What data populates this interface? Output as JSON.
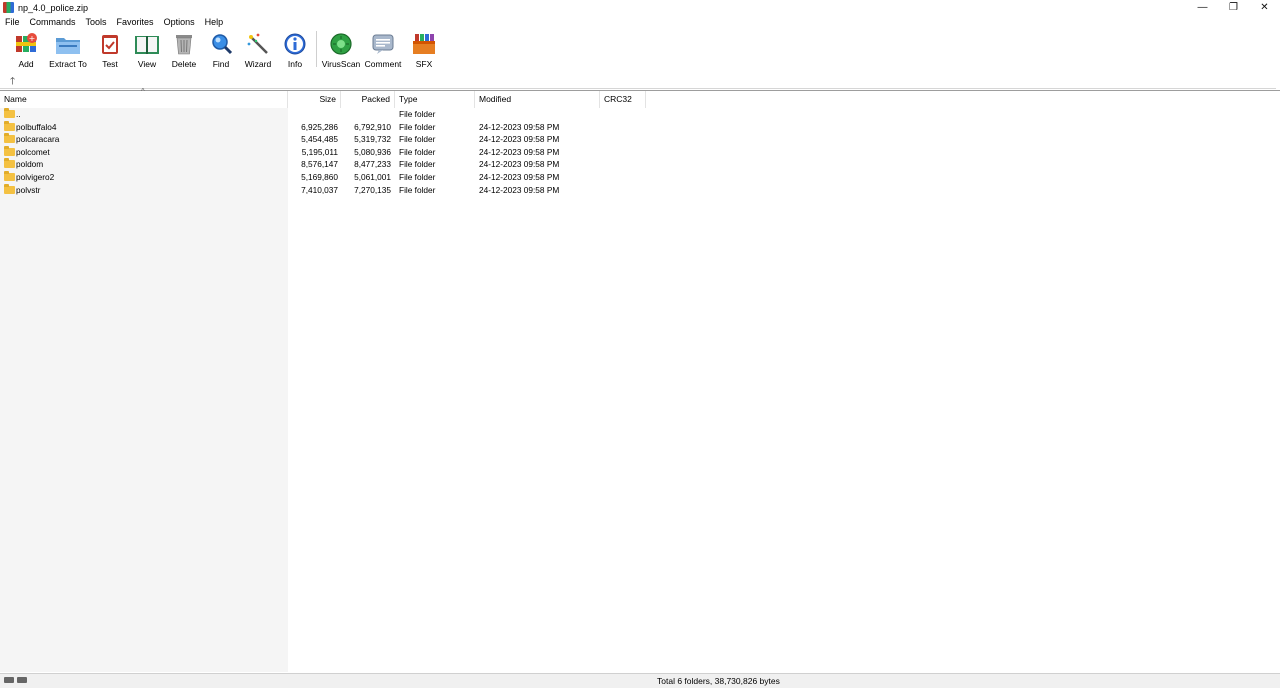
{
  "window": {
    "title": "np_4.0_police.zip",
    "controls": {
      "minimize": "—",
      "restore": "❐",
      "close": "✕"
    }
  },
  "menu": [
    "File",
    "Commands",
    "Tools",
    "Favorites",
    "Options",
    "Help"
  ],
  "toolbar": [
    {
      "label": "Add",
      "icon": "add-archive-icon"
    },
    {
      "label": "Extract To",
      "icon": "extract-folder-icon"
    },
    {
      "label": "Test",
      "icon": "test-clipboard-icon"
    },
    {
      "label": "View",
      "icon": "view-book-icon"
    },
    {
      "label": "Delete",
      "icon": "trash-icon"
    },
    {
      "label": "Find",
      "icon": "magnifier-icon"
    },
    {
      "label": "Wizard",
      "icon": "magic-wand-icon"
    },
    {
      "label": "Info",
      "icon": "info-icon"
    },
    {
      "label": "VirusScan",
      "icon": "virus-scan-icon"
    },
    {
      "label": "Comment",
      "icon": "comment-icon"
    },
    {
      "label": "SFX",
      "icon": "sfx-box-icon"
    }
  ],
  "address": {
    "up_symbol": "🡑"
  },
  "columns": {
    "name": "Name",
    "size": "Size",
    "packed": "Packed",
    "type": "Type",
    "modified": "Modified",
    "crc32": "CRC32",
    "sort_caret": "^"
  },
  "files": [
    {
      "name": "..",
      "size": "",
      "packed": "",
      "type": "File folder",
      "modified": ""
    },
    {
      "name": "polbuffalo4",
      "size": "6,925,286",
      "packed": "6,792,910",
      "type": "File folder",
      "modified": "24-12-2023 09:58 PM"
    },
    {
      "name": "polcaracara",
      "size": "5,454,485",
      "packed": "5,319,732",
      "type": "File folder",
      "modified": "24-12-2023 09:58 PM"
    },
    {
      "name": "polcomet",
      "size": "5,195,011",
      "packed": "5,080,936",
      "type": "File folder",
      "modified": "24-12-2023 09:58 PM"
    },
    {
      "name": "poldom",
      "size": "8,576,147",
      "packed": "8,477,233",
      "type": "File folder",
      "modified": "24-12-2023 09:58 PM"
    },
    {
      "name": "polvigero2",
      "size": "5,169,860",
      "packed": "5,061,001",
      "type": "File folder",
      "modified": "24-12-2023 09:58 PM"
    },
    {
      "name": "polvstr",
      "size": "7,410,037",
      "packed": "7,270,135",
      "type": "File folder",
      "modified": "24-12-2023 09:58 PM"
    }
  ],
  "status": {
    "text": "Total 6 folders, 38,730,826 bytes"
  }
}
